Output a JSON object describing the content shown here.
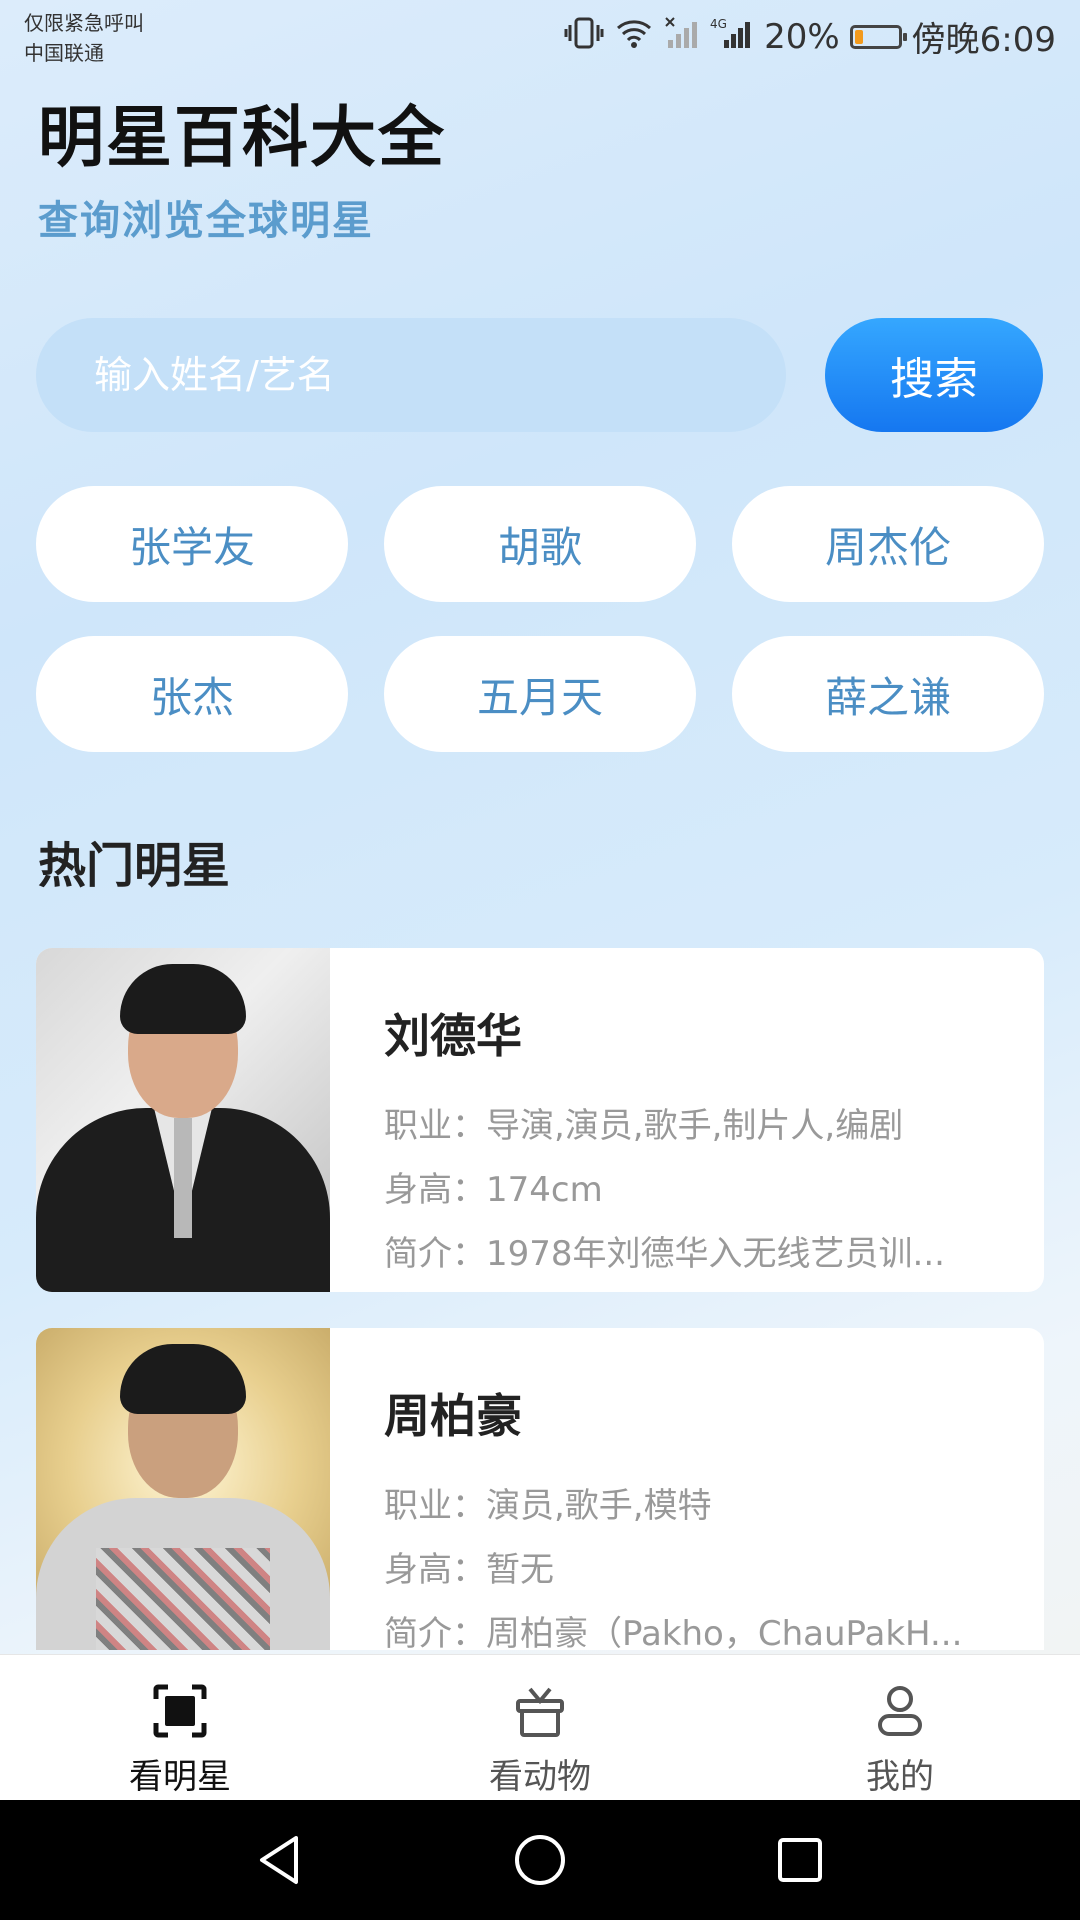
{
  "status_bar": {
    "carrier_line1": "仅限紧急呼叫",
    "carrier_line2": "中国联通",
    "network": "4G",
    "battery_text": "20%",
    "battery_level": 0.2,
    "time": "傍晚6:09"
  },
  "header": {
    "title": "明星百科大全",
    "subtitle": "查询浏览全球明星"
  },
  "search": {
    "placeholder": "输入姓名/艺名",
    "button_label": "搜索"
  },
  "quick_tags": [
    "张学友",
    "胡歌",
    "周杰伦",
    "张杰",
    "五月天",
    "薛之谦"
  ],
  "section": {
    "title": "热门明星"
  },
  "stars": [
    {
      "name": "刘德华",
      "occupation": "职业：导演,演员,歌手,制片人,编剧",
      "height": "身高：174cm",
      "intro": "简介：1978年刘德华入无线艺员训..."
    },
    {
      "name": "周柏豪",
      "occupation": "职业：演员,歌手,模特",
      "height": "身高：暂无",
      "intro": "简介：周柏豪（Pakho，ChauPakH..."
    }
  ],
  "bottom_nav": {
    "items": [
      {
        "label": "看明星",
        "icon": "scan-icon",
        "active": true
      },
      {
        "label": "看动物",
        "icon": "gift-box-icon",
        "active": false
      },
      {
        "label": "我的",
        "icon": "person-icon",
        "active": false
      }
    ]
  },
  "colors": {
    "accent": "#1a7df0",
    "subtitle": "#5b9ccd",
    "chip_text": "#4b8ec4"
  }
}
